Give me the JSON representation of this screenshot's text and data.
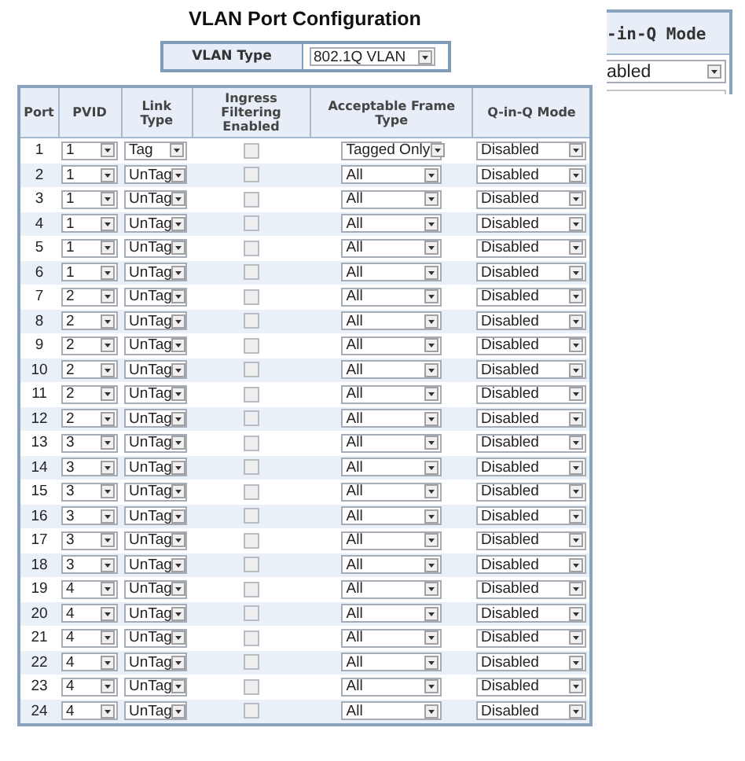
{
  "title": "VLAN Port Configuration",
  "vlan_type": {
    "label": "VLAN Type",
    "value": "802.1Q VLAN"
  },
  "table": {
    "columns": [
      "Port",
      "PVID",
      "Link Type",
      "Ingress Filtering Enabled",
      "Acceptable Frame Type",
      "Q-in-Q Mode"
    ],
    "rows": [
      {
        "port": "1",
        "pvid": "1",
        "link_type": "Tag",
        "ingress_checked": false,
        "frame_type": "Tagged Only",
        "qinq_mode": "Disabled"
      },
      {
        "port": "2",
        "pvid": "1",
        "link_type": "UnTag",
        "ingress_checked": false,
        "frame_type": "All",
        "qinq_mode": "Disabled"
      },
      {
        "port": "3",
        "pvid": "1",
        "link_type": "UnTag",
        "ingress_checked": false,
        "frame_type": "All",
        "qinq_mode": "Disabled"
      },
      {
        "port": "4",
        "pvid": "1",
        "link_type": "UnTag",
        "ingress_checked": false,
        "frame_type": "All",
        "qinq_mode": "Disabled"
      },
      {
        "port": "5",
        "pvid": "1",
        "link_type": "UnTag",
        "ingress_checked": false,
        "frame_type": "All",
        "qinq_mode": "Disabled"
      },
      {
        "port": "6",
        "pvid": "1",
        "link_type": "UnTag",
        "ingress_checked": false,
        "frame_type": "All",
        "qinq_mode": "Disabled"
      },
      {
        "port": "7",
        "pvid": "2",
        "link_type": "UnTag",
        "ingress_checked": false,
        "frame_type": "All",
        "qinq_mode": "Disabled"
      },
      {
        "port": "8",
        "pvid": "2",
        "link_type": "UnTag",
        "ingress_checked": false,
        "frame_type": "All",
        "qinq_mode": "Disabled"
      },
      {
        "port": "9",
        "pvid": "2",
        "link_type": "UnTag",
        "ingress_checked": false,
        "frame_type": "All",
        "qinq_mode": "Disabled"
      },
      {
        "port": "10",
        "pvid": "2",
        "link_type": "UnTag",
        "ingress_checked": false,
        "frame_type": "All",
        "qinq_mode": "Disabled"
      },
      {
        "port": "11",
        "pvid": "2",
        "link_type": "UnTag",
        "ingress_checked": false,
        "frame_type": "All",
        "qinq_mode": "Disabled"
      },
      {
        "port": "12",
        "pvid": "2",
        "link_type": "UnTag",
        "ingress_checked": false,
        "frame_type": "All",
        "qinq_mode": "Disabled"
      },
      {
        "port": "13",
        "pvid": "3",
        "link_type": "UnTag",
        "ingress_checked": false,
        "frame_type": "All",
        "qinq_mode": "Disabled"
      },
      {
        "port": "14",
        "pvid": "3",
        "link_type": "UnTag",
        "ingress_checked": false,
        "frame_type": "All",
        "qinq_mode": "Disabled"
      },
      {
        "port": "15",
        "pvid": "3",
        "link_type": "UnTag",
        "ingress_checked": false,
        "frame_type": "All",
        "qinq_mode": "Disabled"
      },
      {
        "port": "16",
        "pvid": "3",
        "link_type": "UnTag",
        "ingress_checked": false,
        "frame_type": "All",
        "qinq_mode": "Disabled"
      },
      {
        "port": "17",
        "pvid": "3",
        "link_type": "UnTag",
        "ingress_checked": false,
        "frame_type": "All",
        "qinq_mode": "Disabled"
      },
      {
        "port": "18",
        "pvid": "3",
        "link_type": "UnTag",
        "ingress_checked": false,
        "frame_type": "All",
        "qinq_mode": "Disabled"
      },
      {
        "port": "19",
        "pvid": "4",
        "link_type": "UnTag",
        "ingress_checked": false,
        "frame_type": "All",
        "qinq_mode": "Disabled"
      },
      {
        "port": "20",
        "pvid": "4",
        "link_type": "UnTag",
        "ingress_checked": false,
        "frame_type": "All",
        "qinq_mode": "Disabled"
      },
      {
        "port": "21",
        "pvid": "4",
        "link_type": "UnTag",
        "ingress_checked": false,
        "frame_type": "All",
        "qinq_mode": "Disabled"
      },
      {
        "port": "22",
        "pvid": "4",
        "link_type": "UnTag",
        "ingress_checked": false,
        "frame_type": "All",
        "qinq_mode": "Disabled"
      },
      {
        "port": "23",
        "pvid": "4",
        "link_type": "UnTag",
        "ingress_checked": false,
        "frame_type": "All",
        "qinq_mode": "Disabled"
      },
      {
        "port": "24",
        "pvid": "4",
        "link_type": "UnTag",
        "ingress_checked": false,
        "frame_type": "All",
        "qinq_mode": "Disabled"
      }
    ]
  },
  "inset": {
    "header": "-in-Q Mode",
    "value": "abled"
  }
}
